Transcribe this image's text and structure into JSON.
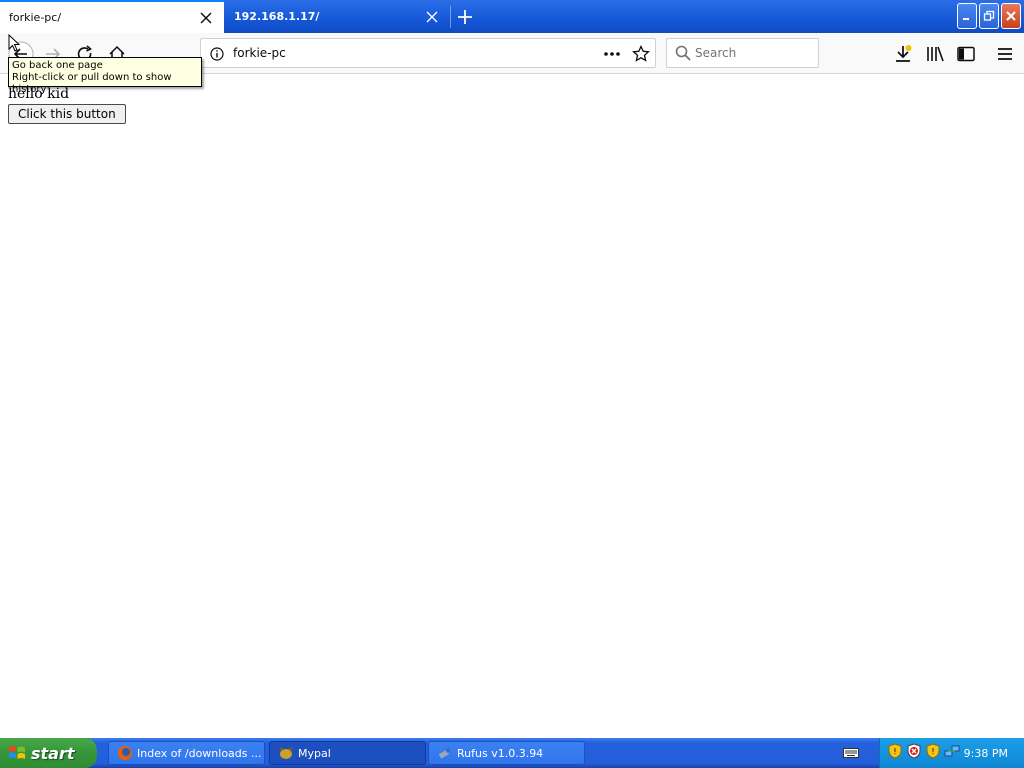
{
  "browser": {
    "tabs": [
      {
        "title": "forkie-pc/",
        "active": true
      },
      {
        "title": "192.168.1.17/",
        "active": false
      }
    ],
    "url": "forkie-pc",
    "search_placeholder": "Search",
    "tooltip": {
      "line1": "Go back one page",
      "line2": "Right-click or pull down to show history"
    }
  },
  "page": {
    "text": "hello kid",
    "button_label": "Click this button"
  },
  "taskbar": {
    "start_label": "start",
    "items": [
      {
        "label": "Index of /downloads ...",
        "icon": "firefox-icon",
        "pressed": false
      },
      {
        "label": "Mypal",
        "icon": "mypal-icon",
        "pressed": true
      },
      {
        "label": "Rufus v1.0.3.94",
        "icon": "rufus-icon",
        "pressed": false
      }
    ],
    "clock": "9:38 PM"
  },
  "colors": {
    "titlebar": "#1557d6",
    "taskbar": "#245edb",
    "start": "#36953a",
    "tray": "#0f86d4",
    "tooltip_bg": "#ffffe1",
    "accent": "#0a84ff"
  }
}
